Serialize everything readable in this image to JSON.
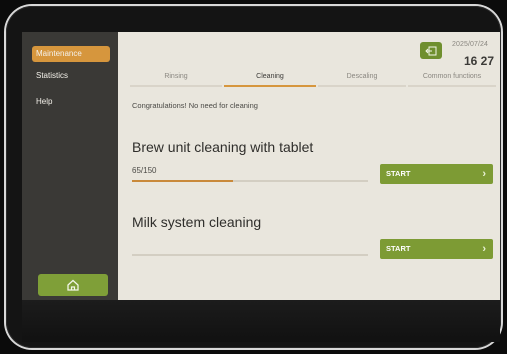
{
  "sidebar": {
    "items": [
      {
        "label": "Maintenance",
        "active": true
      },
      {
        "label": "Statistics",
        "active": false
      },
      {
        "label": "Help",
        "active": false
      }
    ]
  },
  "header": {
    "date": "2025/07/24",
    "time": "16 27"
  },
  "tabs": [
    {
      "label": "Rinsing",
      "active": false
    },
    {
      "label": "Cleaning",
      "active": true
    },
    {
      "label": "Descaling",
      "active": false
    },
    {
      "label": "Common functions",
      "active": false
    }
  ],
  "status_message": "Congratulations! No need for cleaning",
  "brew_unit": {
    "title": "Brew unit cleaning with tablet",
    "count": "65/150",
    "progress": 0.43,
    "button_label": "START"
  },
  "milk_system": {
    "title": "Milk system cleaning",
    "progress": 0.0,
    "button_label": "START"
  },
  "colors": {
    "accent": "#d6963d",
    "button": "#7d9b34",
    "sidebar": "#3a3936",
    "background": "#e9e6dd"
  }
}
